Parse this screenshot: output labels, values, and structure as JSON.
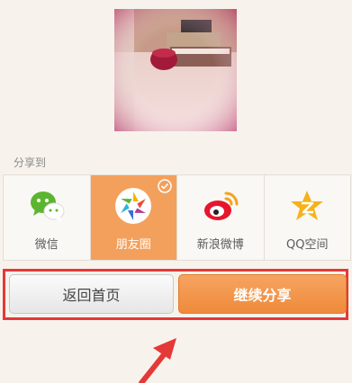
{
  "share": {
    "label": "分享到",
    "options": [
      {
        "label": "微信",
        "icon": "wechat-icon",
        "selected": false
      },
      {
        "label": "朋友圈",
        "icon": "moments-icon",
        "selected": true
      },
      {
        "label": "新浪微博",
        "icon": "weibo-icon",
        "selected": false
      },
      {
        "label": "QQ空间",
        "icon": "qzone-icon",
        "selected": false
      }
    ]
  },
  "actions": {
    "back_label": "返回首页",
    "continue_label": "继续分享"
  },
  "colors": {
    "selected_tile": "#f3a05c",
    "continue_button": "#ef8a3a",
    "highlight_box": "#e53838",
    "annotation_arrow": "#e53838"
  }
}
